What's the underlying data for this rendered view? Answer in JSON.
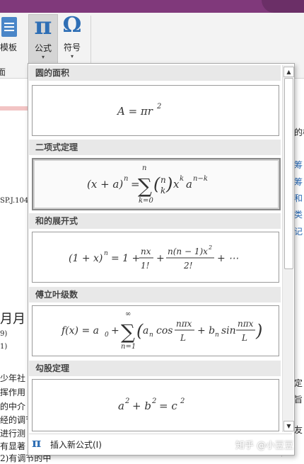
{
  "ribbon": {
    "template_label": "模板",
    "formula_label": "公式",
    "formula_glyph": "π",
    "symbol_label": "符号",
    "symbol_glyph": "Ω",
    "group_label": "面",
    "caret": "▾"
  },
  "document": {
    "left_lines": [
      "SP.J.104",
      "月月",
      "9)",
      "1)",
      "少年社",
      "挥作用",
      "的中介",
      "经的调节",
      "进行测",
      "有显著",
      "2)有调节的中"
    ],
    "right_lines": [
      "的楼",
      "筹",
      "筹",
      "和",
      "类",
      "记",
      "定",
      "旨",
      "友"
    ]
  },
  "gallery": {
    "sections": [
      {
        "title": "圆的面积",
        "formula": "A = πr²"
      },
      {
        "title": "二项式定理",
        "formula": "(x + a)ⁿ = Σ_{k=0}^{n} (n k) xᵏ aⁿ⁻ᵏ"
      },
      {
        "title": "和的展开式",
        "formula": "(1 + x)ⁿ = 1 + nx/1! + n(n − 1)x²/2! + ⋯"
      },
      {
        "title": "傅立叶级数",
        "formula": "f(x) = a₀ + Σ_{n=1}^{∞} (aₙ cos nπx/L + bₙ sin nπx/L)"
      },
      {
        "title": "勾股定理",
        "formula": "a² + b² = c²"
      }
    ],
    "footer_label": "插入新公式(I)",
    "footer_glyph": "π"
  },
  "watermark": "知乎 @小豆豆",
  "colors": {
    "ribbon_accent": "#80397b",
    "icon_blue": "#2f6fb5"
  }
}
